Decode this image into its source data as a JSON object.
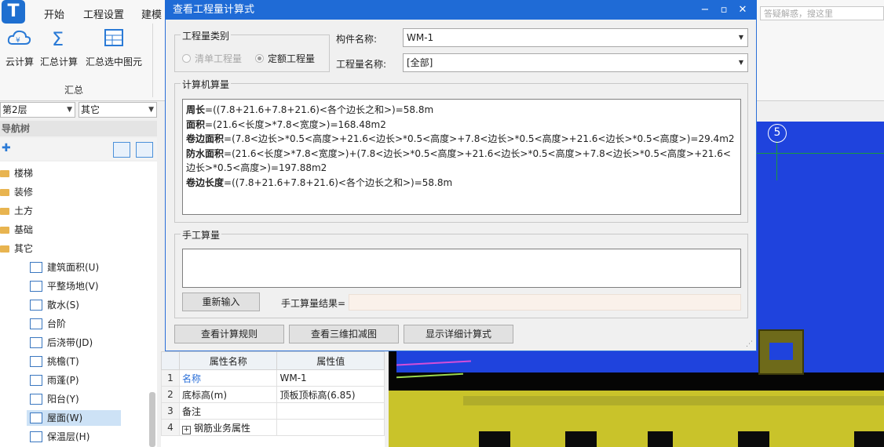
{
  "ribbon": {
    "tabs": [
      "开始",
      "工程设置",
      "建模"
    ],
    "buttons": {
      "cloud_calc": "云计算",
      "summary_calc": "汇总计算",
      "summary_selected": "汇总选中图元"
    },
    "group_label": "汇总",
    "search_placeholder": "答疑解惑，搜这里",
    "colors": {
      "accent": "#1f6bd6"
    }
  },
  "left_panel": {
    "floor_select": "第2层",
    "category_select": "其它",
    "nav_title": "导航树",
    "tree": {
      "folders": [
        "楼梯",
        "装修",
        "土方",
        "基础",
        "其它"
      ],
      "items": [
        "建筑面积(U)",
        "平整场地(V)",
        "散水(S)",
        "台阶",
        "后浇带(JD)",
        "挑檐(T)",
        "雨蓬(P)",
        "阳台(Y)",
        "屋面(W)",
        "保温层(H)"
      ],
      "selected": "屋面(W)"
    }
  },
  "properties": {
    "headers": [
      "属性名称",
      "属性值"
    ],
    "rows": [
      {
        "idx": "1",
        "name": "名称",
        "value": "WM-1"
      },
      {
        "idx": "2",
        "name": "底标高(m)",
        "value": "顶板顶标高(6.85)"
      },
      {
        "idx": "3",
        "name": "备注",
        "value": ""
      },
      {
        "idx": "4",
        "name": "钢筋业务属性",
        "value": ""
      }
    ]
  },
  "viewport": {
    "axis_label": "5"
  },
  "dialog": {
    "title": "查看工程量计算式",
    "qty_category_label": "工程量类别",
    "radio_list_qty": "清单工程量",
    "radio_quota_qty": "定额工程量",
    "component_name_label": "构件名称:",
    "component_name_value": "WM-1",
    "qty_name_label": "工程量名称:",
    "qty_name_value": "[全部]",
    "computer_calc_label": "计算机算量",
    "formulas": [
      {
        "name": "周长",
        "expr": "=((7.8+21.6+7.8+21.6)<各个边长之和>)=58.8m"
      },
      {
        "name": "面积",
        "expr": "=(21.6<长度>*7.8<宽度>)=168.48m2"
      },
      {
        "name": "卷边面积",
        "expr": "=(7.8<边长>*0.5<高度>+21.6<边长>*0.5<高度>+7.8<边长>*0.5<高度>+21.6<边长>*0.5<高度>)=29.4m2"
      },
      {
        "name": "防水面积",
        "expr": "=(21.6<长度>*7.8<宽度>)+(7.8<边长>*0.5<高度>+21.6<边长>*0.5<高度>+7.8<边长>*0.5<高度>+21.6<边长>*0.5<高度>)=197.88m2"
      },
      {
        "name": "卷边长度",
        "expr": "=((7.8+21.6+7.8+21.6)<各个边长之和>)=58.8m"
      }
    ],
    "manual_calc_label": "手工算量",
    "reenter_button": "重新输入",
    "manual_result_label": "手工算量结果=",
    "view_rules_button": "查看计算规则",
    "view_3d_button": "查看三维扣减图",
    "detail_button": "显示详细计算式"
  }
}
